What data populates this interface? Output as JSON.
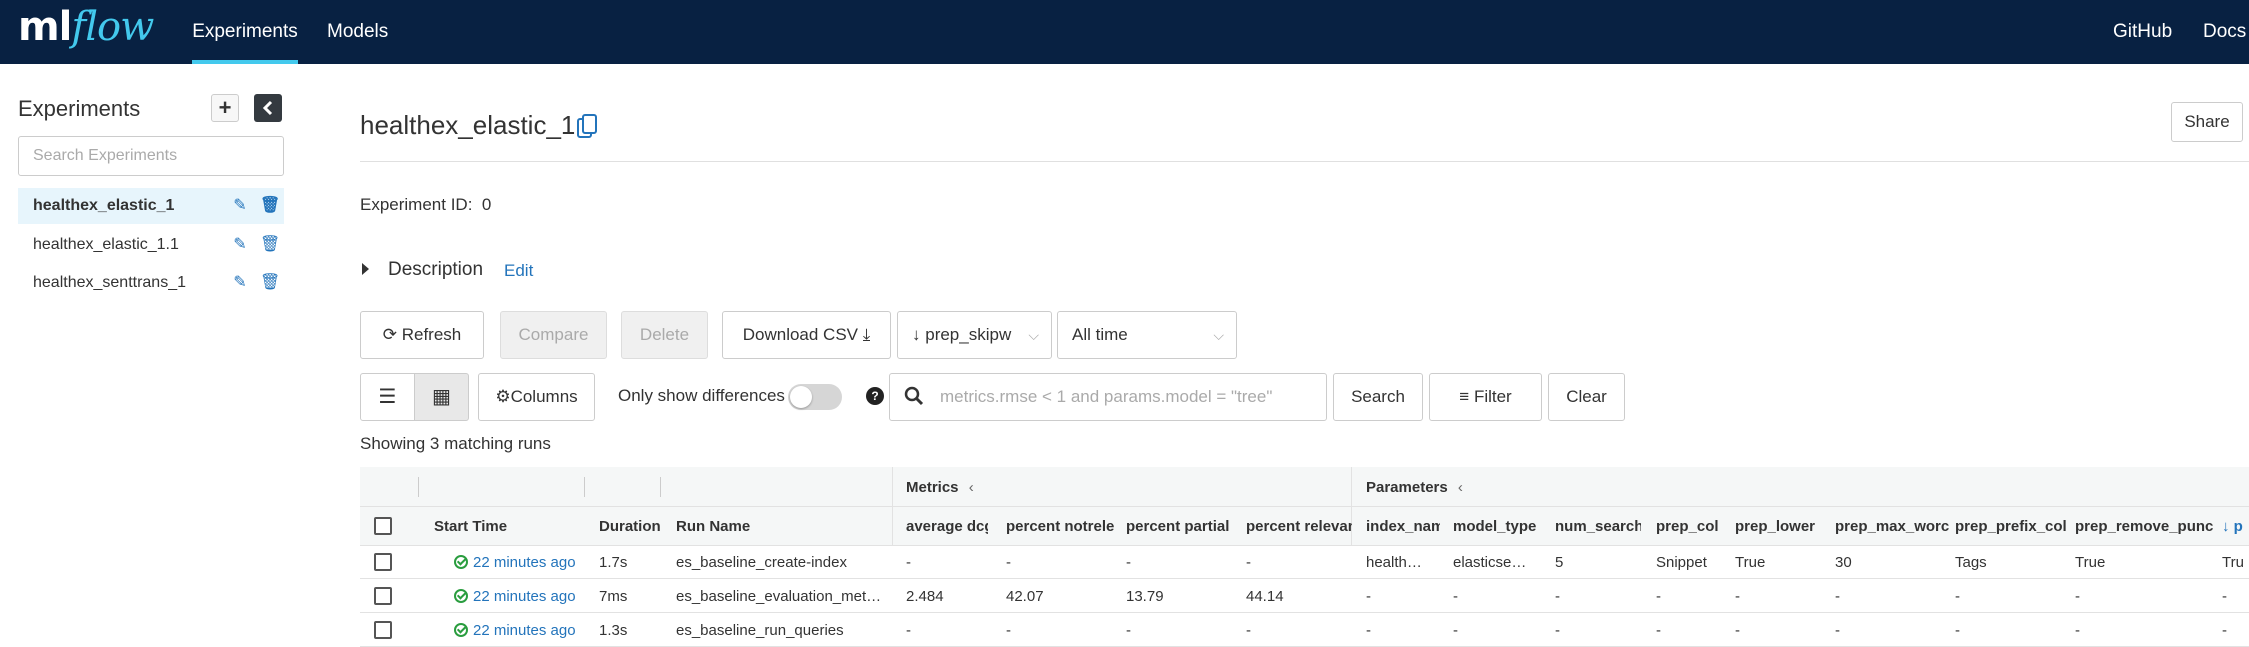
{
  "nav": {
    "logo_ml": "ml",
    "logo_flow": "flow",
    "tabs": [
      "Experiments",
      "Models"
    ],
    "github": "GitHub",
    "docs": "Docs"
  },
  "sidebar": {
    "title": "Experiments",
    "search_placeholder": "Search Experiments",
    "items": [
      {
        "label": "healthex_elastic_1",
        "active": true
      },
      {
        "label": "healthex_elastic_1.1",
        "active": false
      },
      {
        "label": "healthex_senttrans_1",
        "active": false
      }
    ]
  },
  "main": {
    "title": "healthex_elastic_1",
    "share": "Share",
    "experiment_id_label": "Experiment ID:",
    "experiment_id": "0",
    "description_label": "Description",
    "edit_label": "Edit",
    "toolbar": {
      "refresh": "Refresh",
      "compare": "Compare",
      "delete": "Delete",
      "download": "Download CSV",
      "sort_value": "prep_skipw",
      "time_value": "All time",
      "columns": "Columns",
      "only_diff": "Only show differences",
      "search_placeholder": "metrics.rmse < 1 and params.model = \"tree\"",
      "search": "Search",
      "filter": "Filter",
      "clear": "Clear"
    },
    "showing": "Showing 3 matching runs"
  },
  "grid": {
    "groups": {
      "metrics": "Metrics",
      "parameters": "Parameters"
    },
    "headers": [
      "Start Time",
      "Duration",
      "Run Name",
      "average dcg",
      "percent notrele",
      "percent partial",
      "percent relevan",
      "index_nam",
      "model_type",
      "num_search_",
      "prep_col",
      "prep_lower",
      "prep_max_worc",
      "prep_prefix_col",
      "prep_remove_punct",
      "↓ p"
    ],
    "rows": [
      [
        "22 minutes ago",
        "1.7s",
        "es_baseline_create-index",
        "-",
        "-",
        "-",
        "-",
        "health…",
        "elasticse…",
        "5",
        "Snippet",
        "True",
        "30",
        "Tags",
        "True",
        "Tru"
      ],
      [
        "22 minutes ago",
        "7ms",
        "es_baseline_evaluation_met…",
        "2.484",
        "42.07",
        "13.79",
        "44.14",
        "-",
        "-",
        "-",
        "-",
        "-",
        "-",
        "-",
        "-",
        "-"
      ],
      [
        "22 minutes ago",
        "1.3s",
        "es_baseline_run_queries",
        "-",
        "-",
        "-",
        "-",
        "-",
        "-",
        "-",
        "-",
        "-",
        "-",
        "-",
        "-",
        "-"
      ]
    ]
  }
}
